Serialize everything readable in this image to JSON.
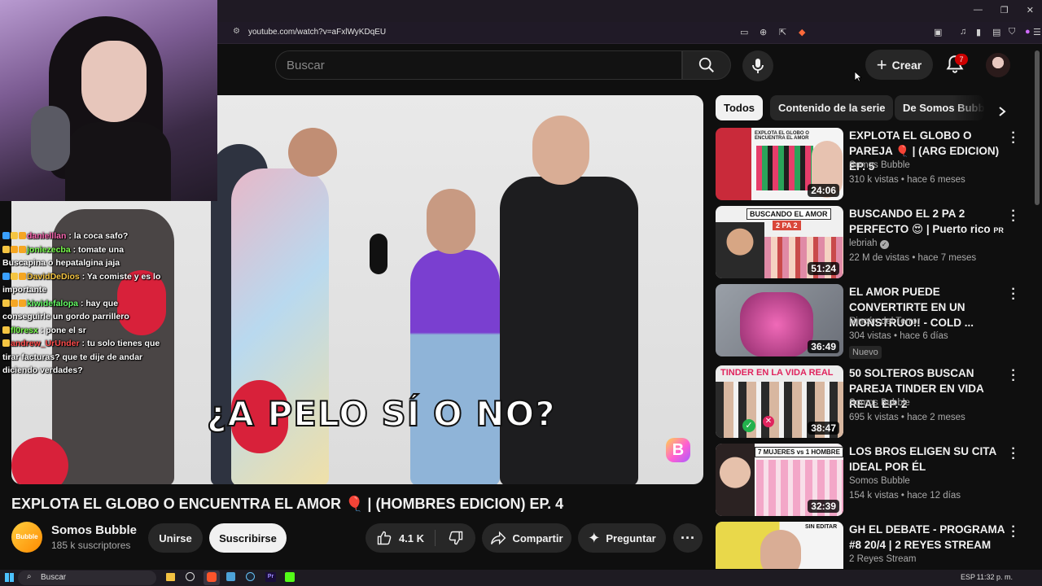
{
  "browser": {
    "url": "youtube.com/watch?v=aFxlWyKDqEU",
    "window_controls": [
      "—",
      "❐",
      "✕"
    ]
  },
  "header": {
    "search_placeholder": "Buscar",
    "create_label": "Crear",
    "notification_count": "7"
  },
  "chips": [
    "Todos",
    "Contenido de la serie",
    "De Somos Bubble"
  ],
  "video": {
    "caption_text": "¿A PELO SÍ O NO?",
    "logo_letter": "B",
    "title": "EXPLOTA EL GLOBO O ENCUENTRA EL AMOR 🎈 | (HOMBRES EDICION) EP. 4",
    "channel": "Somos Bubble",
    "channel_avatar_text": "Bubble",
    "subscribers": "185 k suscriptores",
    "join_label": "Unirse",
    "subscribe_label": "Suscribirse",
    "like_count": "4.1 K",
    "share_label": "Compartir",
    "ask_label": "Preguntar"
  },
  "chat": [
    {
      "user": "danielllan",
      "color": "#ff69b4",
      "text": ": la coca safo?"
    },
    {
      "user": "joniezecba",
      "color": "#7cff4f",
      "text": ": tomate una Buscapina o hepatalgina jaja"
    },
    {
      "user": "DavidDeDios",
      "color": "#f5c542",
      "text": ": Ya comiste y es lo importante"
    },
    {
      "user": "kiwidefalopa",
      "color": "#66ff66",
      "text": ": hay que conseguirle un gordo parrillero"
    },
    {
      "user": "fl0resx",
      "color": "#7cff4f",
      "text": ": pone el sr"
    },
    {
      "user": "andrew_UrUnder",
      "color": "#ff4d4d",
      "text": ": tu solo tienes que tirar facturas? que te dije de andar diciendo verdades?"
    }
  ],
  "recommendations": [
    {
      "title": "EXPLOTA EL GLOBO O PAREJA 🎈 | (ARG EDICION) EP. 5",
      "channel": "Somos Bubble",
      "meta": "310 k vistas • hace 6 meses",
      "duration": "24:06",
      "thumb_text": "EXPLOTA EL GLOBO O ENCUENTRA EL AMOR",
      "thumb_color": "#c92a3a"
    },
    {
      "title": "BUSCANDO EL 2 PA 2 PERFECTO 😍 | Puerto rico",
      "title_suffix": "PR",
      "channel": "lebriah",
      "verified": true,
      "meta": "22 M de vistas • hace 7 meses",
      "duration": "51:24",
      "thumb_text": "BUSCANDO EL AMOR",
      "thumb_text2": "2 PA 2",
      "thumb_color": "#d9473a"
    },
    {
      "title": "EL AMOR PUEDE CONVERTIRTE EN UN MONSTRUO!! - COLD ...",
      "channel": "Rincón del Terror",
      "meta": "304 vistas • hace 6 días",
      "badge": "Nuevo",
      "duration": "36:49",
      "thumb_color": "#b43a8e"
    },
    {
      "title": "50 SOLTEROS BUSCAN PAREJA TINDER EN VIDA REAL EP. 2",
      "channel": "Somos Bubble",
      "meta": "695 k vistas • hace 2 meses",
      "duration": "38:47",
      "thumb_text": "TINDER EN LA VIDA REAL",
      "thumb_color": "#e8e8e8"
    },
    {
      "title": "LOS BROS ELIGEN SU CITA IDEAL POR ÉL",
      "channel": "Somos Bubble",
      "meta": "154 k vistas • hace 12 días",
      "duration": "32:39",
      "thumb_text": "7 MUJERES vs 1 HOMBRE",
      "thumb_color": "#f3c3dd"
    },
    {
      "title": "GH EL DEBATE - PROGRAMA #8 20/4 | 2 REYES STREAM",
      "channel": "2 Reyes Stream",
      "meta": "",
      "duration": "",
      "thumb_text": "SIN EDITAR",
      "thumb_color": "#e9d84a"
    }
  ],
  "taskbar": {
    "search_label": "Buscar",
    "lang": "ESP",
    "clock": "11:32 p. m."
  }
}
